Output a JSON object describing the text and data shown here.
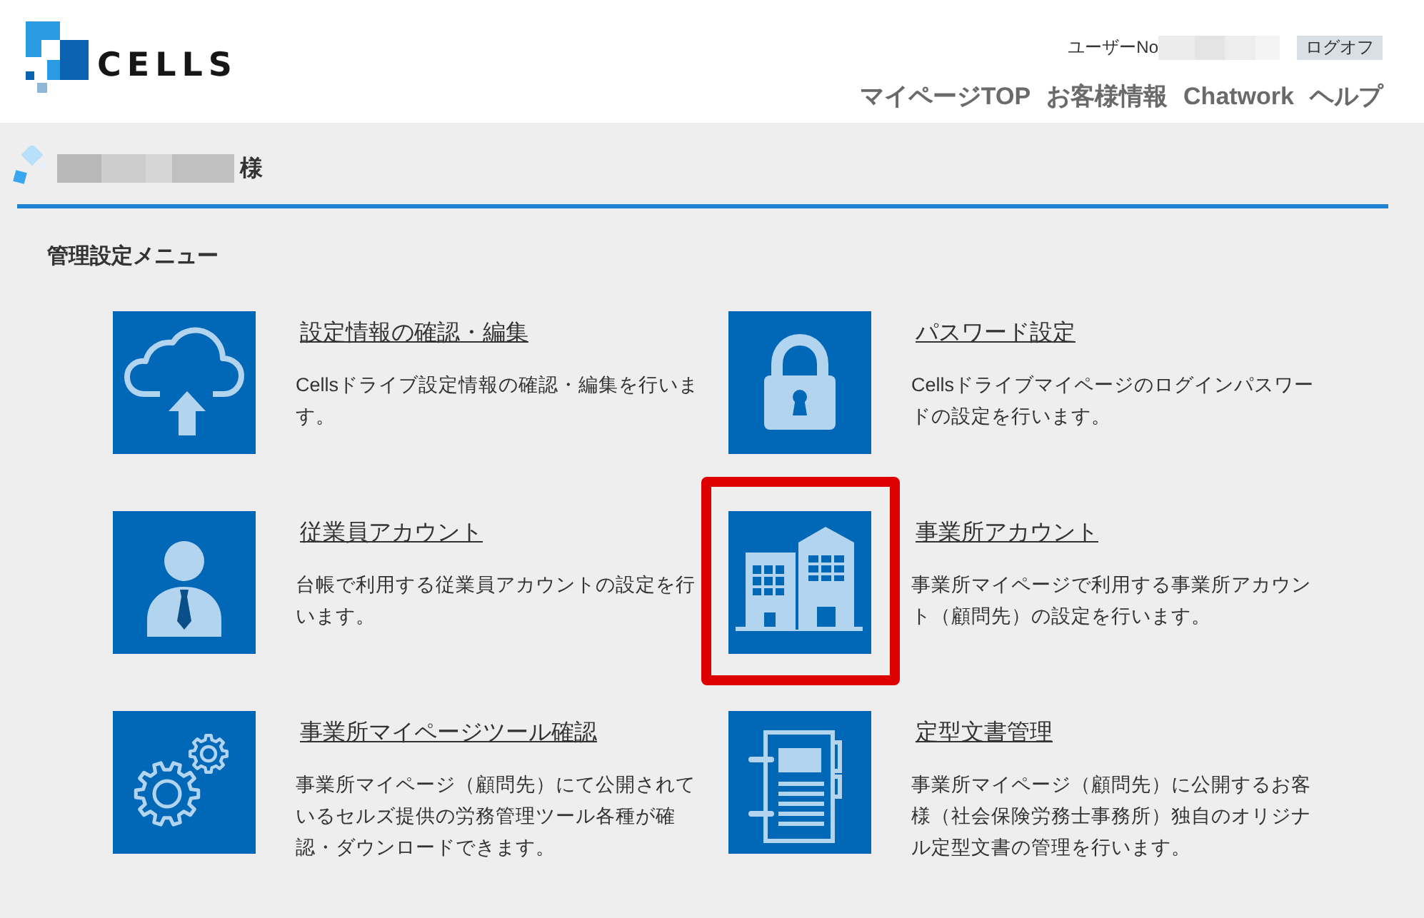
{
  "header": {
    "logo_text": "CELLS",
    "user_label": "ユーザーNo",
    "logoff_button": "ログオフ",
    "nav": [
      "マイページTOP",
      "お客様情報",
      "Chatwork",
      "ヘルプ"
    ]
  },
  "greeting": {
    "suffix": "様"
  },
  "section_title": "管理設定メニュー",
  "menu_items": [
    {
      "title": "設定情報の確認・編集",
      "description": "Cellsドライブ設定情報の確認・編集を行います。",
      "highlighted": false
    },
    {
      "title": "パスワード設定",
      "description": "Cellsドライブマイページのログインパスワードの設定を行います。",
      "highlighted": false
    },
    {
      "title": "従業員アカウント",
      "description": "台帳で利用する従業員アカウントの設定を行います。",
      "highlighted": false
    },
    {
      "title": "事業所アカウント",
      "description": "事業所マイページで利用する事業所アカウント（顧問先）の設定を行います。",
      "highlighted": true
    },
    {
      "title": "事業所マイページツール確認",
      "description": "事業所マイページ（顧問先）にて公開されているセルズ提供の労務管理ツール各種が確認・ダウンロードできます。",
      "highlighted": false
    },
    {
      "title": "定型文書管理",
      "description": "事業所マイページ（顧問先）に公開するお客様（社会保険労務士事務所）独自のオリジナル定型文書の管理を行います。",
      "highlighted": false
    }
  ]
}
